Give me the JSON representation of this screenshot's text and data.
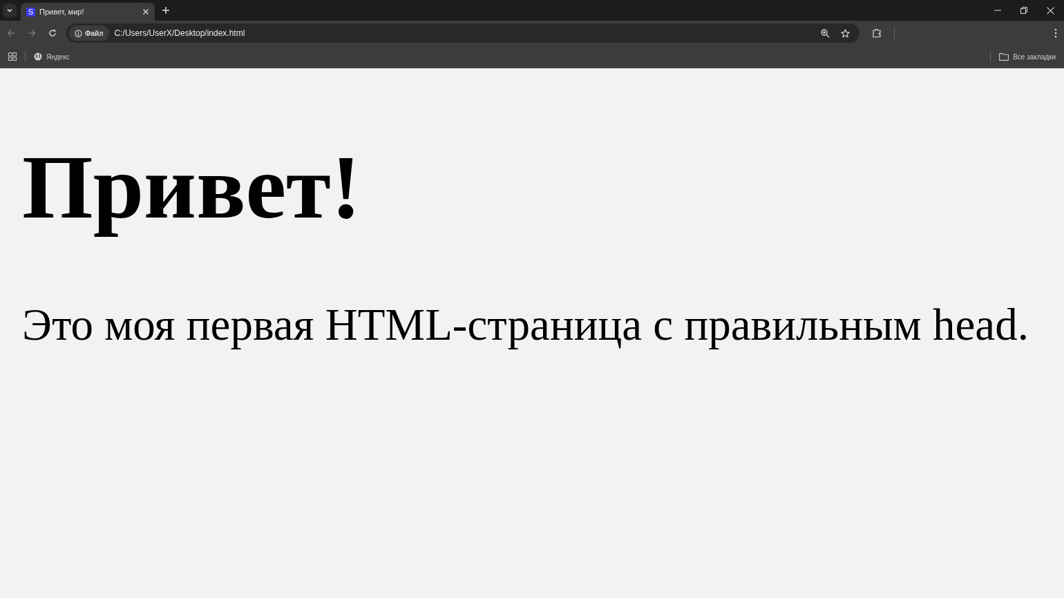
{
  "tabs": [
    {
      "favicon": "S",
      "title": "Привет, мир!",
      "selected": true
    }
  ],
  "toolbar": {
    "site_info": "Файл",
    "address": "C:/Users/UserX/Desktop/index.html"
  },
  "bookmarks": {
    "items": [
      "Яндекс"
    ],
    "all_bookmarks": "Все закладки"
  },
  "page": {
    "heading": "Привет!",
    "paragraph": "Это моя первая HTML-страница с правильным head."
  }
}
